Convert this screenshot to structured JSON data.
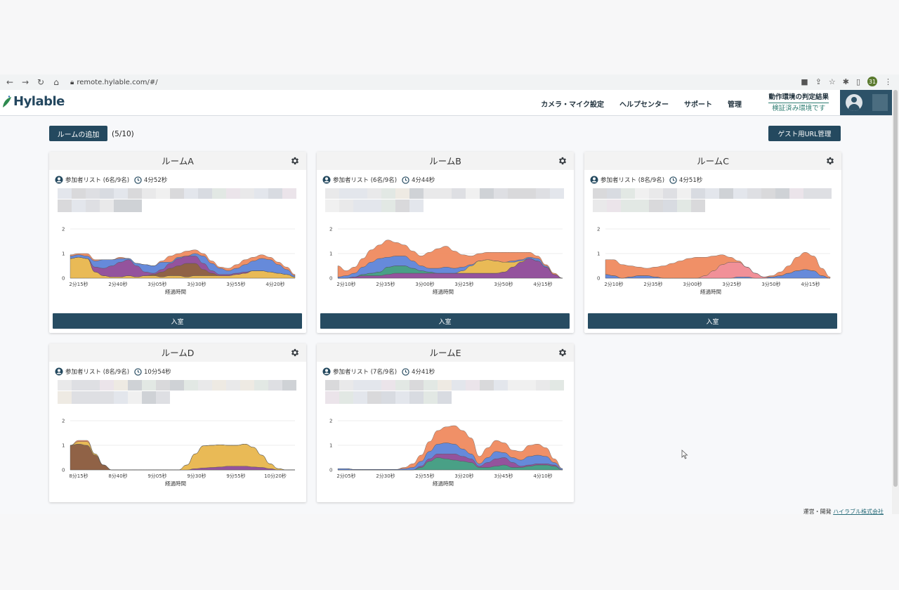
{
  "browser": {
    "url": "remote.hylable.com/#/",
    "profile_initial": "31"
  },
  "header": {
    "logo_text": "Hylable",
    "nav": [
      "カメラ・マイク設定",
      "ヘルプセンター",
      "サポート",
      "管理"
    ],
    "env_title": "動作環境の判定結果",
    "env_status": "検証済み環境です"
  },
  "toolbar": {
    "add_room_label": "ルームの追加",
    "room_count": "(5/10)",
    "guest_url_label": "ゲスト用URL管理"
  },
  "xaxis_label": "経過時間",
  "enter_label": "入室",
  "footer": {
    "prefix": "運営・開発",
    "company": "ハイラブル株式会社"
  },
  "colors": {
    "primary": "#24495f",
    "orange": "#ef8a5f",
    "blue": "#5e84d8",
    "purple": "#8e4a98",
    "gold": "#e8b64d",
    "green": "#3f9b80",
    "brown": "#8a5a3c"
  },
  "rooms": [
    {
      "name": "ルームA",
      "participants": "参加者リスト (6名/9名)",
      "time": "4分52秒",
      "chart_data": {
        "type": "area",
        "ylim": [
          0,
          2
        ],
        "yticks": [
          0,
          1,
          2
        ],
        "xticks": [
          "2分15秒",
          "2分40秒",
          "3分05秒",
          "3分30秒",
          "3分55秒",
          "4分20秒"
        ],
        "series": [
          {
            "color": "#e8b64d",
            "values": [
              0.8,
              0.85,
              0.8,
              0.25,
              0.1,
              0.05,
              0.05,
              0.1,
              0.05,
              0.1,
              0.1,
              0.05,
              0.1,
              0.1,
              0.05,
              0.1,
              0.1,
              0.1,
              0.1,
              0.1,
              0.15,
              0.2,
              0.3,
              0.3,
              0.25,
              0.2,
              0.15,
              0.05
            ]
          },
          {
            "color": "#8a5a3c",
            "values": [
              0,
              0,
              0,
              0,
              0,
              0,
              0,
              0,
              0,
              0,
              0.05,
              0.2,
              0.3,
              0.4,
              0.55,
              0.5,
              0.25,
              0.1,
              0,
              0,
              0,
              0,
              0,
              0,
              0,
              0,
              0,
              0
            ]
          },
          {
            "color": "#8e4a98",
            "values": [
              0,
              0,
              0,
              0.2,
              0.3,
              0.45,
              0.6,
              0.65,
              0.45,
              0.15,
              0.05,
              0.1,
              0.2,
              0.3,
              0.3,
              0.3,
              0.25,
              0.1,
              0.05,
              0.05,
              0.05,
              0.05,
              0,
              0,
              0,
              0,
              0,
              0
            ]
          },
          {
            "color": "#5e84d8",
            "values": [
              0.1,
              0.1,
              0.1,
              0.25,
              0.35,
              0.25,
              0.15,
              0.05,
              0.1,
              0.3,
              0.3,
              0.3,
              0.05,
              0.05,
              0,
              0.1,
              0.3,
              0.3,
              0.25,
              0.15,
              0.2,
              0.3,
              0.4,
              0.5,
              0.5,
              0.35,
              0.2,
              0.05
            ]
          },
          {
            "color": "#ef8a5f",
            "values": [
              0.05,
              0.05,
              0.1,
              0.05,
              0,
              0,
              0.05,
              0,
              0,
              0,
              0,
              0.05,
              0.25,
              0.15,
              0.2,
              0.15,
              0.1,
              0.1,
              0.05,
              0.1,
              0.15,
              0.2,
              0.15,
              0.15,
              0.1,
              0.1,
              0.1,
              0.05
            ]
          }
        ]
      }
    },
    {
      "name": "ルームB",
      "participants": "参加者リスト (6名/9名)",
      "time": "4分44秒",
      "chart_data": {
        "type": "area",
        "ylim": [
          0,
          2
        ],
        "yticks": [
          0,
          1,
          2
        ],
        "xticks": [
          "2分10秒",
          "2分35秒",
          "3分00秒",
          "3分25秒",
          "3分50秒",
          "4分15秒"
        ],
        "series": [
          {
            "color": "#8e4a98",
            "values": [
              0,
              0,
              0.05,
              0.1,
              0.1,
              0.1,
              0.15,
              0.2,
              0.2,
              0.2,
              0.2,
              0.2,
              0.2,
              0.2,
              0.2,
              0.2,
              0.2,
              0.2,
              0.2,
              0.2,
              0.25,
              0.45,
              0.65,
              0.8,
              0.7,
              0.45,
              0.15,
              0
            ]
          },
          {
            "color": "#3f9b80",
            "values": [
              0,
              0,
              0,
              0.05,
              0.1,
              0.15,
              0.3,
              0.3,
              0.3,
              0.2,
              0.1,
              0.05,
              0,
              0,
              0,
              0,
              0,
              0,
              0,
              0,
              0,
              0,
              0,
              0,
              0,
              0,
              0,
              0
            ]
          },
          {
            "color": "#e8b64d",
            "values": [
              0,
              0,
              0,
              0,
              0,
              0,
              0,
              0,
              0,
              0,
              0,
              0,
              0,
              0,
              0,
              0.1,
              0.3,
              0.5,
              0.55,
              0.5,
              0.4,
              0.2,
              0.05,
              0,
              0,
              0,
              0,
              0
            ]
          },
          {
            "color": "#5e84d8",
            "values": [
              0.05,
              0.1,
              0.15,
              0.3,
              0.45,
              0.55,
              0.4,
              0.4,
              0.4,
              0.3,
              0.2,
              0.15,
              0.2,
              0.25,
              0.2,
              0.15,
              0.05,
              0,
              0,
              0,
              0,
              0.05,
              0.05,
              0.05,
              0.1,
              0.05,
              0,
              0
            ]
          },
          {
            "color": "#ef8a5f",
            "values": [
              0.45,
              0.2,
              0.25,
              0.35,
              0.5,
              0.55,
              0.7,
              0.55,
              0.45,
              0.4,
              0.4,
              0.65,
              0.8,
              0.85,
              0.7,
              0.5,
              0.35,
              0.3,
              0.3,
              0.35,
              0.4,
              0.35,
              0.3,
              0.2,
              0.1,
              0.05,
              0.05,
              0
            ]
          }
        ]
      }
    },
    {
      "name": "ルームC",
      "participants": "参加者リスト (8名/9名)",
      "time": "4分51秒",
      "chart_data": {
        "type": "area",
        "ylim": [
          0,
          2
        ],
        "yticks": [
          0,
          1,
          2
        ],
        "xticks": [
          "2分10秒",
          "2分35秒",
          "3分00秒",
          "3分25秒",
          "3分50秒",
          "4分15秒"
        ],
        "series": [
          {
            "color": "#5e84d8",
            "values": [
              0.15,
              0.1,
              0,
              0.05,
              0.1,
              0.1,
              0.05,
              0,
              0,
              0,
              0,
              0,
              0,
              0,
              0,
              0,
              0.05,
              0.05,
              0,
              0,
              0.05,
              0.1,
              0.2,
              0.3,
              0.35,
              0.3,
              0.1,
              0
            ]
          },
          {
            "color": "#f08a92",
            "values": [
              0,
              0,
              0,
              0,
              0,
              0,
              0,
              0,
              0,
              0,
              0,
              0,
              0.1,
              0.3,
              0.55,
              0.65,
              0.6,
              0.4,
              0.2,
              0.05,
              0,
              0,
              0,
              0,
              0,
              0,
              0,
              0
            ]
          },
          {
            "color": "#ef8a5f",
            "values": [
              0.6,
              0.65,
              0.55,
              0.45,
              0.35,
              0.3,
              0.4,
              0.5,
              0.6,
              0.7,
              0.8,
              0.85,
              0.75,
              0.6,
              0.4,
              0.2,
              0.05,
              0,
              0,
              0,
              0.05,
              0.15,
              0.3,
              0.55,
              0.7,
              0.6,
              0.3,
              0.05
            ]
          }
        ]
      }
    },
    {
      "name": "ルームD",
      "participants": "参加者リスト (8名/9名)",
      "time": "10分54秒",
      "chart_data": {
        "type": "area",
        "ylim": [
          0,
          2
        ],
        "yticks": [
          0,
          1,
          2
        ],
        "xticks": [
          "8分15秒",
          "8分40秒",
          "9分05秒",
          "9分30秒",
          "9分55秒",
          "10分20秒"
        ],
        "series": [
          {
            "color": "#8a5a3c",
            "values": [
              1.0,
              1.05,
              1.0,
              0.6,
              0.2,
              0,
              0,
              0,
              0,
              0,
              0,
              0,
              0,
              0,
              0,
              0,
              0,
              0,
              0,
              0,
              0,
              0,
              0,
              0,
              0,
              0,
              0,
              0
            ]
          },
          {
            "color": "#8e4a98",
            "values": [
              0,
              0,
              0,
              0,
              0,
              0,
              0,
              0,
              0,
              0,
              0,
              0,
              0,
              0,
              0,
              0.05,
              0.08,
              0.1,
              0.12,
              0.15,
              0.15,
              0.15,
              0.12,
              0.1,
              0.05,
              0,
              0,
              0
            ]
          },
          {
            "color": "#e8b64d",
            "values": [
              0,
              0.1,
              0.15,
              0.05,
              0,
              0,
              0,
              0,
              0,
              0,
              0,
              0,
              0,
              0,
              0.2,
              0.6,
              0.9,
              0.9,
              0.9,
              0.85,
              0.85,
              0.9,
              0.8,
              0.5,
              0.2,
              0.05,
              0,
              0
            ]
          },
          {
            "color": "#ef8a5f",
            "values": [
              0,
              0.05,
              0.05,
              0,
              0,
              0,
              0,
              0,
              0,
              0,
              0,
              0,
              0,
              0,
              0,
              0,
              0,
              0,
              0,
              0,
              0,
              0,
              0,
              0,
              0,
              0,
              0,
              0
            ]
          }
        ]
      }
    },
    {
      "name": "ルームE",
      "participants": "参加者リスト (7名/9名)",
      "time": "4分41秒",
      "chart_data": {
        "type": "area",
        "ylim": [
          0,
          2
        ],
        "yticks": [
          0,
          1,
          2
        ],
        "xticks": [
          "2分05秒",
          "2分30秒",
          "2分55秒",
          "3分20秒",
          "3分45秒",
          "4分10秒"
        ],
        "series": [
          {
            "color": "#3f9b80",
            "values": [
              0,
              0,
              0,
              0,
              0,
              0,
              0,
              0,
              0,
              0,
              0.1,
              0.35,
              0.5,
              0.45,
              0.4,
              0.35,
              0.3,
              0.1,
              0.1,
              0.15,
              0.2,
              0.1,
              0.1,
              0.15,
              0.2,
              0.2,
              0.15,
              0
            ]
          },
          {
            "color": "#8e4a98",
            "values": [
              0,
              0,
              0,
              0,
              0,
              0,
              0,
              0,
              0,
              0,
              0.05,
              0.1,
              0.15,
              0.2,
              0.25,
              0.2,
              0.15,
              0.05,
              0.2,
              0.3,
              0.3,
              0.2,
              0.05,
              0.05,
              0.05,
              0.05,
              0.05,
              0
            ]
          },
          {
            "color": "#5e84d8",
            "values": [
              0.05,
              0.05,
              0.02,
              0.02,
              0.02,
              0.02,
              0.02,
              0.02,
              0.05,
              0.1,
              0.2,
              0.3,
              0.4,
              0.45,
              0.4,
              0.3,
              0.2,
              0.1,
              0.2,
              0.3,
              0.2,
              0.2,
              0.25,
              0.35,
              0.35,
              0.3,
              0.1,
              0.05
            ]
          },
          {
            "color": "#ef8a5f",
            "values": [
              0,
              0,
              0,
              0,
              0,
              0,
              0,
              0,
              0.05,
              0.15,
              0.25,
              0.4,
              0.55,
              0.65,
              0.75,
              0.75,
              0.65,
              0.3,
              0.4,
              0.45,
              0.4,
              0.3,
              0.35,
              0.45,
              0.45,
              0.35,
              0.15,
              0
            ]
          }
        ]
      }
    }
  ]
}
